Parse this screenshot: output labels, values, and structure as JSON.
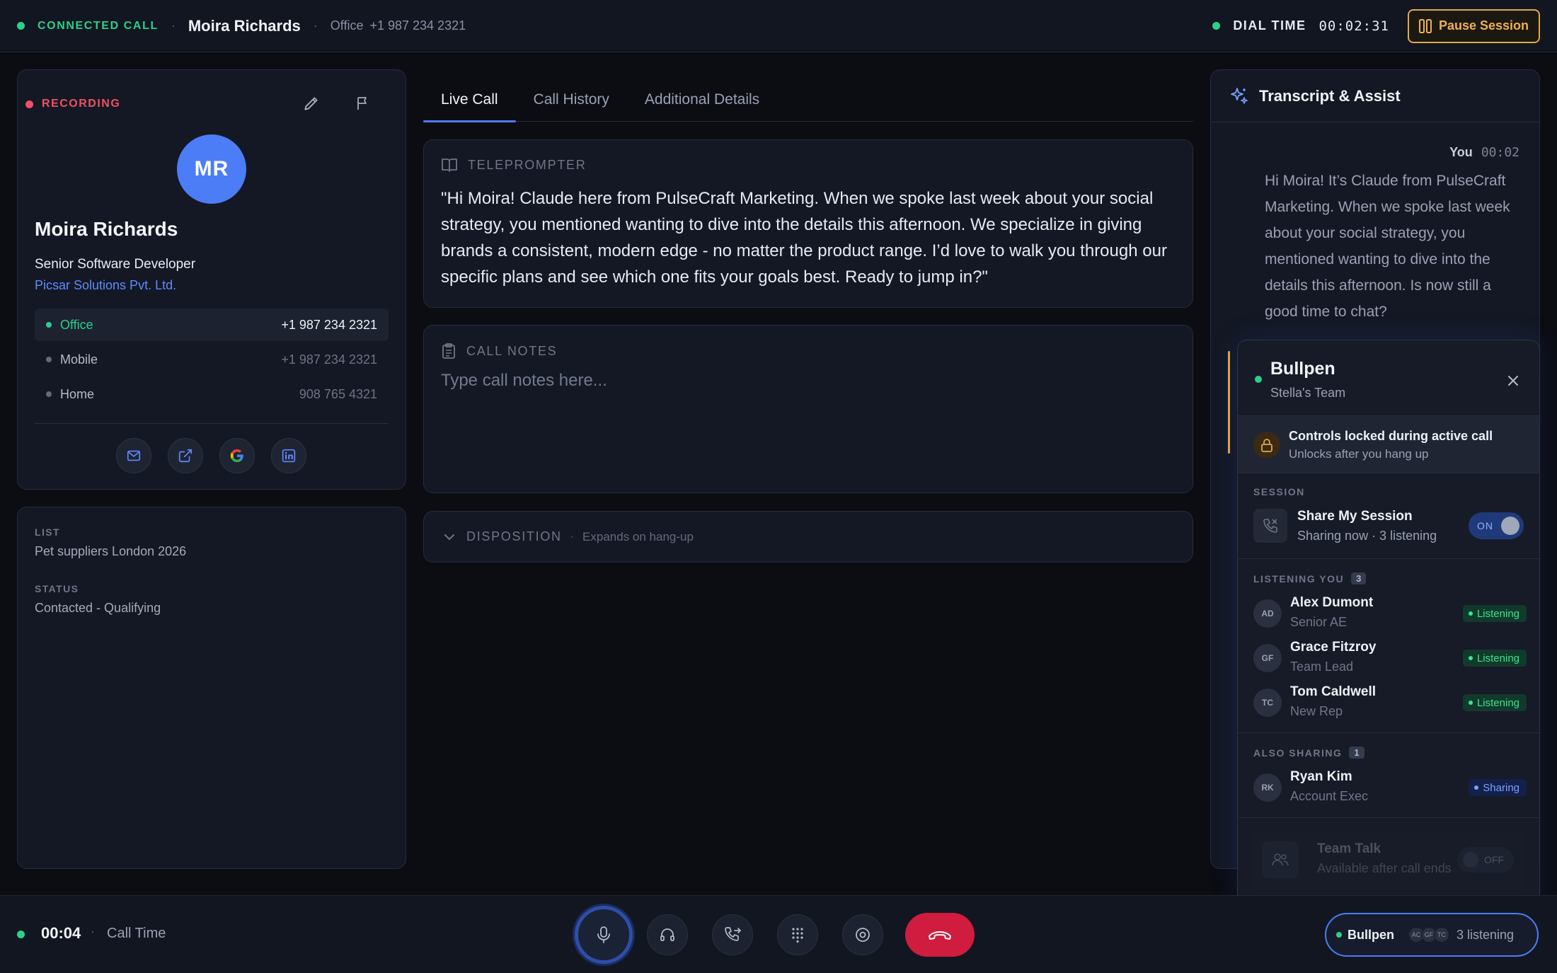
{
  "topbar": {
    "status": "CONNECTED CALL",
    "contact_name": "Moira Richards",
    "phone_label": "Office",
    "phone_number": "+1 987 234 2321",
    "dial_label": "DIAL TIME",
    "dial_time": "00:02:31",
    "pause_label": "Pause Session"
  },
  "contact": {
    "recording_label": "RECORDING",
    "initials": "MR",
    "name": "Moira Richards",
    "title": "Senior Software Developer",
    "company": "Picsar Solutions Pvt. Ltd.",
    "phones": [
      {
        "label": "Office",
        "number": "+1 987 234 2321"
      },
      {
        "label": "Mobile",
        "number": "+1 987 234 2321"
      },
      {
        "label": "Home",
        "number": "908 765 4321"
      }
    ],
    "actions": [
      "mail-icon",
      "external-link-icon",
      "google-icon",
      "linkedin-icon"
    ]
  },
  "list_info": {
    "list_label": "LIST",
    "list_value": "Pet suppliers London 2026",
    "status_label": "STATUS",
    "status_value": "Contacted - Qualifying"
  },
  "tabs": [
    "Live Call",
    "Call History",
    "Additional Details"
  ],
  "teleprompter": {
    "label": "TELEPROMPTER",
    "text": "\"Hi Moira! Claude here from PulseCraft Marketing. When we spoke last week about your social strategy, you mentioned wanting to dive into the details this afternoon. We specialize in giving brands a consistent, modern edge - no matter the product range. I’d love to walk you through our specific plans and see which one fits your goals best. Ready to jump in?\""
  },
  "notes": {
    "label": "CALL NOTES",
    "placeholder": "Type call notes here..."
  },
  "disposition": {
    "label": "DISPOSITION",
    "sub": "Expands on hang-up"
  },
  "transcript": {
    "title": "Transcript & Assist",
    "speaker": "You",
    "time": "00:02",
    "message": "Hi Moira! It’s Claude from PulseCraft Marketing. When we spoke last week about your social strategy, you mentioned wanting to dive into the details this afternoon. Is now still a good time to chat?"
  },
  "bullpen": {
    "title": "Bullpen",
    "team": "Stella's Team",
    "lock_title": "Controls locked during active call",
    "lock_sub": "Unlocks after you hang up",
    "session_label": "SESSION",
    "share_title": "Share My Session",
    "share_sub": "Sharing now · 3 listening",
    "share_toggle": "ON",
    "listening_label": "LISTENING YOU",
    "listening_count": "3",
    "listeners": [
      {
        "initials": "AD",
        "name": "Alex Dumont",
        "role": "Senior AE",
        "status": "Listening"
      },
      {
        "initials": "GF",
        "name": "Grace Fitzroy",
        "role": "Team Lead",
        "status": "Listening"
      },
      {
        "initials": "TC",
        "name": "Tom Caldwell",
        "role": "New Rep",
        "status": "Listening"
      }
    ],
    "sharing_label": "ALSO SHARING",
    "sharing_count": "1",
    "sharers": [
      {
        "initials": "RK",
        "name": "Ryan Kim",
        "role": "Account Exec",
        "status": "Sharing"
      }
    ],
    "teamtalk_title": "Team Talk",
    "teamtalk_sub": "Available after call ends",
    "teamtalk_toggle": "OFF"
  },
  "bottombar": {
    "call_time": "00:04",
    "call_label": "Call Time",
    "pill_label": "Bullpen",
    "pill_avatars": [
      "AC",
      "GF",
      "TC"
    ],
    "pill_count": "3 listening"
  },
  "colors": {
    "accent": "#4c7df6",
    "success": "#2bd08a",
    "danger": "#d01c3e",
    "warning": "#e0a94a"
  }
}
